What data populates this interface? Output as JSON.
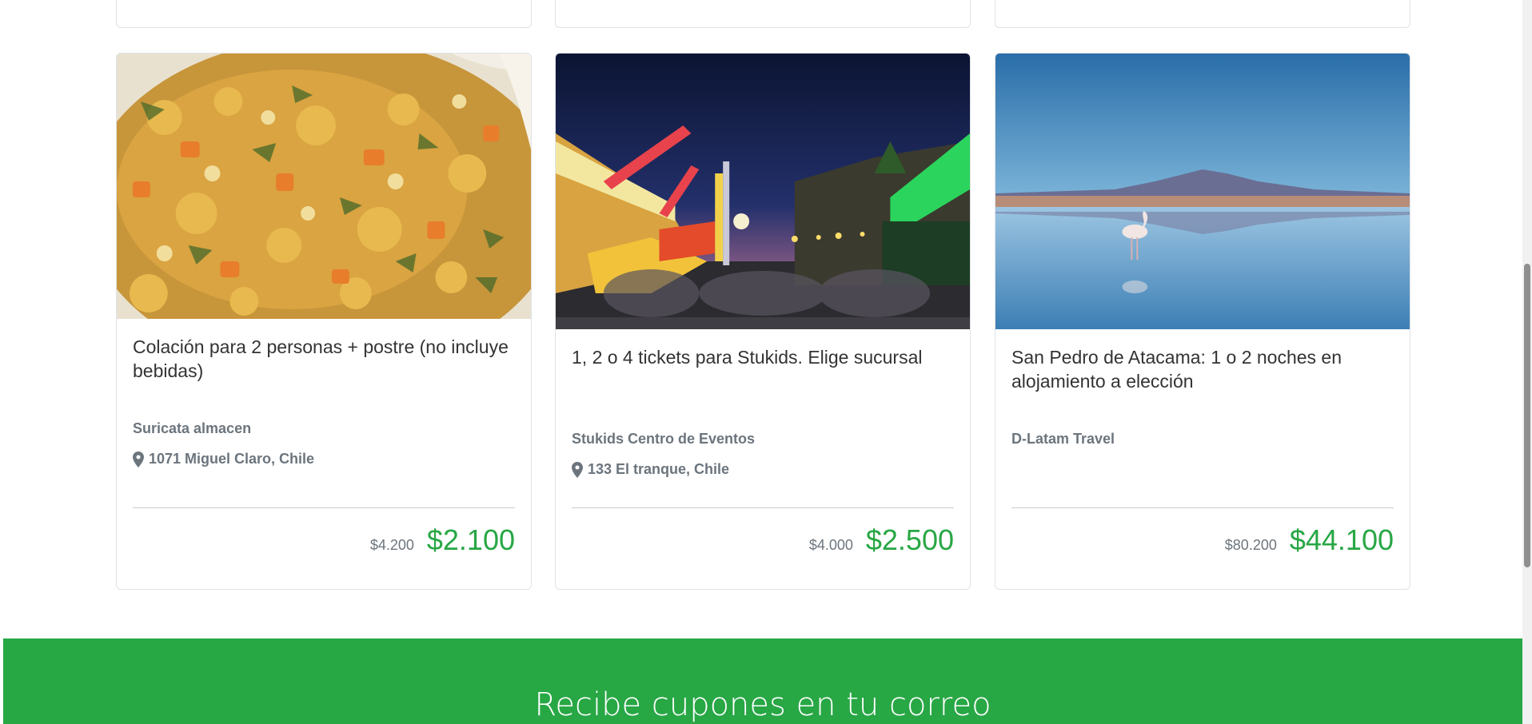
{
  "deals": [
    {
      "title": "Colación para 2 personas + postre (no incluye bebidas)",
      "merchant": "Suricata almacen",
      "address": "1071 Miguel Claro, Chile",
      "old_price": "$4.200",
      "new_price": "$2.100",
      "image": "food-dish-image"
    },
    {
      "title": "1, 2 o 4 tickets para Stukids. Elige sucursal",
      "merchant": "Stukids Centro de Eventos",
      "address": "133 El tranque, Chile",
      "old_price": "$4.000",
      "new_price": "$2.500",
      "image": "amusement-park-image"
    },
    {
      "title": "San Pedro de Atacama: 1 o 2 noches en alojamiento a elección",
      "merchant": "D-Latam Travel",
      "address": "",
      "old_price": "$80.200",
      "new_price": "$44.100",
      "image": "flamingo-lagoon-image"
    }
  ],
  "newsletter": {
    "heading": "Recibe cupones en tu correo"
  },
  "colors": {
    "accent_green": "#28a745",
    "muted_text": "#6c757d"
  },
  "icons": {
    "address_marker": "map-marker-icon"
  }
}
